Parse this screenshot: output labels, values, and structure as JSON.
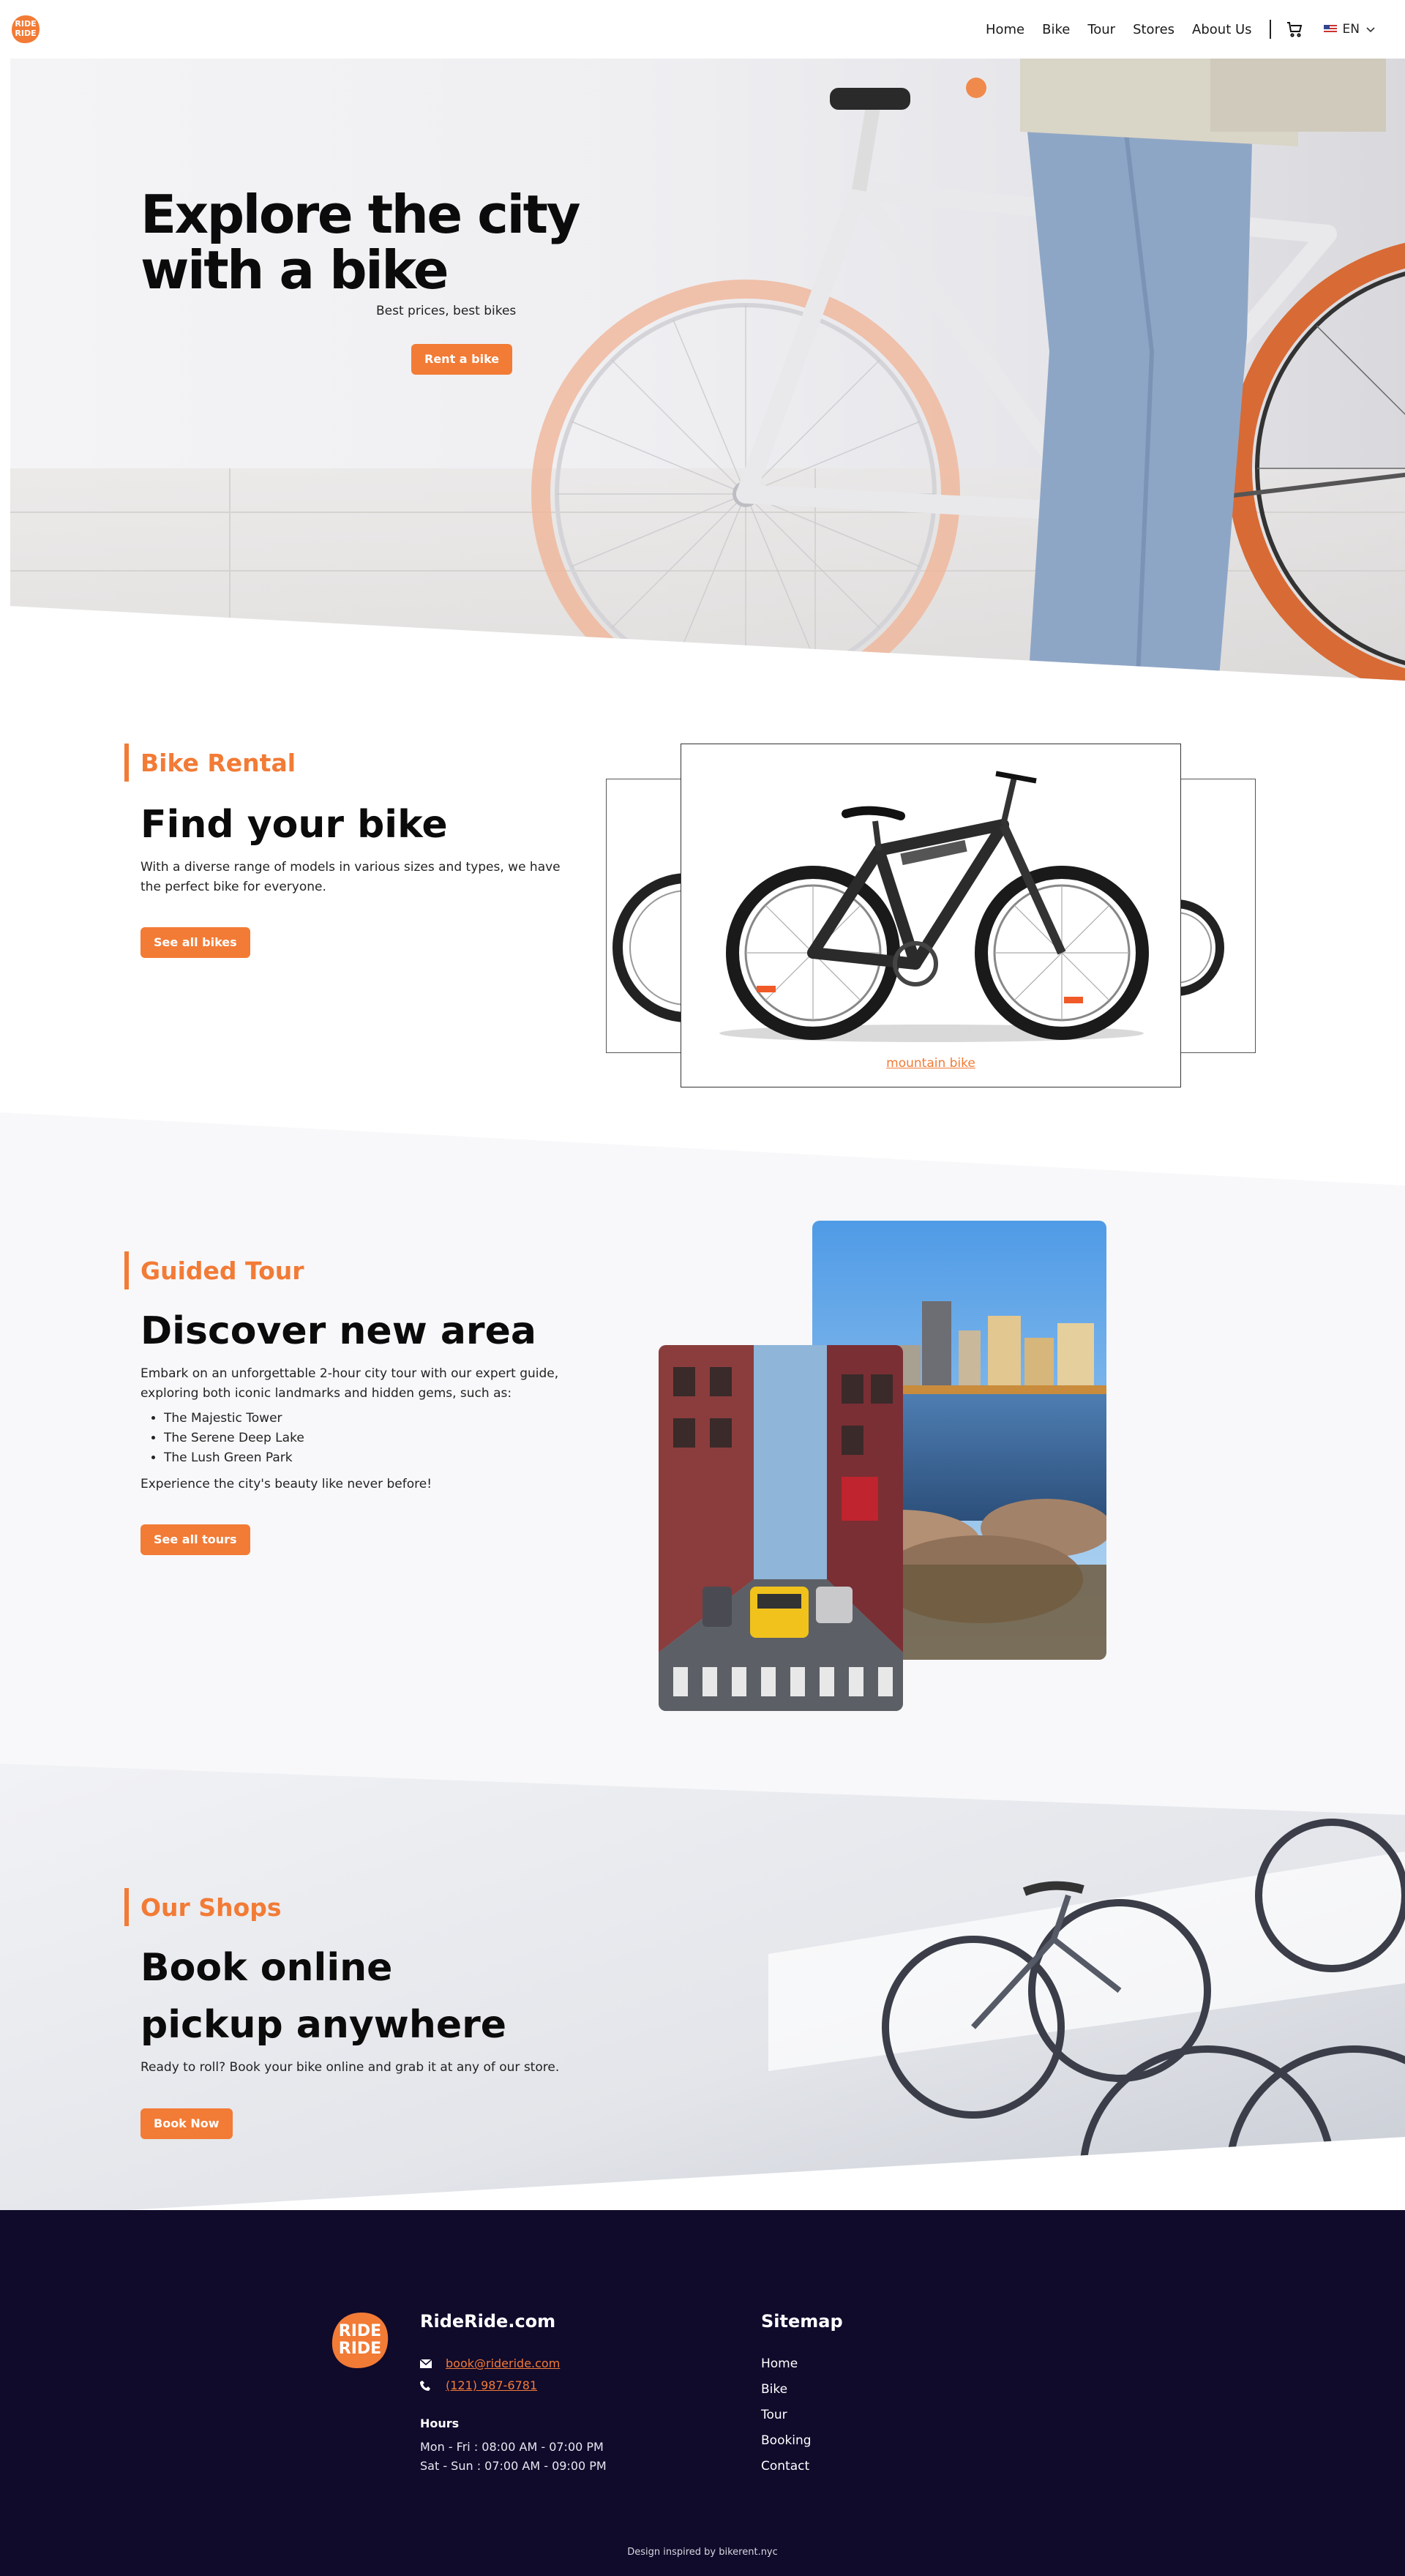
{
  "nav": {
    "logo_text": "RIDE RIDE",
    "links": [
      "Home",
      "Bike",
      "Tour",
      "Stores",
      "About Us"
    ],
    "lang": "EN"
  },
  "hero": {
    "title": "Explore the city with a bike",
    "subtitle": "Best prices, best bikes",
    "cta": "Rent a bike"
  },
  "rental": {
    "tag": "Bike Rental",
    "heading": "Find your bike",
    "text": "With a diverse range of models in various sizes and types, we have the perfect bike for everyone.",
    "cta": "See all bikes",
    "card_caption": "mountain bike"
  },
  "tour": {
    "tag": "Guided Tour",
    "heading": "Discover new area",
    "text": "Embark on an unforgettable 2-hour city tour with our expert guide, exploring both iconic landmarks and hidden gems, such as:",
    "list": [
      "The Majestic Tower",
      "The Serene Deep Lake",
      "The Lush Green Park"
    ],
    "closing": "Experience the city's beauty like never before!",
    "cta": "See all tours"
  },
  "shops": {
    "tag": "Our Shops",
    "heading_line1": "Book online",
    "heading_line2": "pickup anywhere",
    "text": "Ready to roll? Book your bike online and grab it at any of our store.",
    "cta": "Book Now"
  },
  "footer": {
    "brand": "RideRide.com",
    "email": "book@rideride.com",
    "phone": "(121) 987-6781",
    "hours_title": "Hours",
    "hours": [
      "Mon - Fri : 08:00 AM - 07:00 PM",
      "Sat - Sun : 07:00 AM - 09:00 PM"
    ],
    "sitemap_title": "Sitemap",
    "sitemap": [
      "Home",
      "Bike",
      "Tour",
      "Booking",
      "Contact"
    ],
    "credit": "Design inspired by bikerent.nyc"
  },
  "colors": {
    "accent": "#f27b36",
    "footer_bg": "#100a2b",
    "tour_bg": "#f8f8fa"
  }
}
